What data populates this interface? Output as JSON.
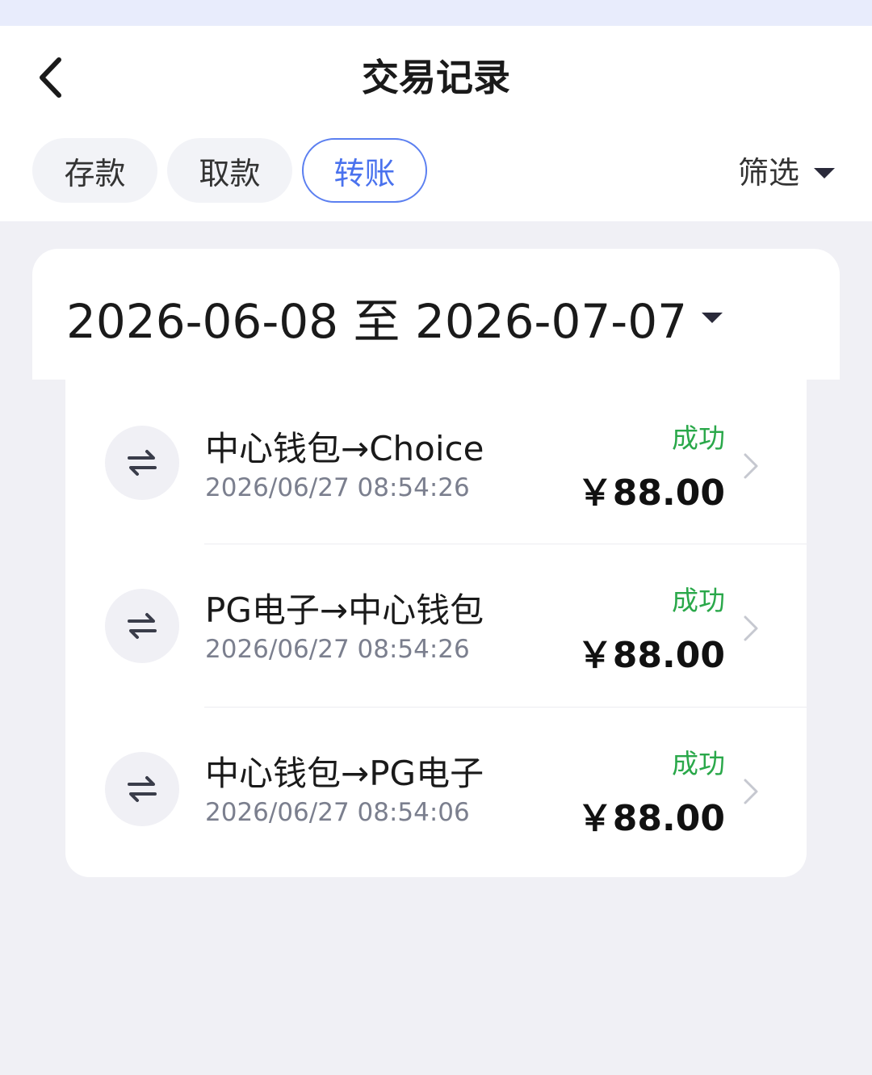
{
  "header": {
    "title": "交易记录",
    "back_icon": "chevron-left-icon"
  },
  "tabs": [
    {
      "label": "存款",
      "active": false
    },
    {
      "label": "取款",
      "active": false
    },
    {
      "label": "转账",
      "active": true
    }
  ],
  "filter": {
    "label": "筛选",
    "icon": "caret-down-icon"
  },
  "date_range": {
    "text": "2026-06-08 至 2026-07-07",
    "icon": "caret-down-icon"
  },
  "transactions": [
    {
      "title": "中心钱包→Choice",
      "time": "2026/06/27 08:54:26",
      "status": "成功",
      "amount": "￥88.00",
      "icon": "transfer-icon"
    },
    {
      "title": "PG电子→中心钱包",
      "time": "2026/06/27 08:54:26",
      "status": "成功",
      "amount": "￥88.00",
      "icon": "transfer-icon"
    },
    {
      "title": "中心钱包→PG电子",
      "time": "2026/06/27 08:54:06",
      "status": "成功",
      "amount": "￥88.00",
      "icon": "transfer-icon"
    }
  ],
  "colors": {
    "accent": "#4a72ee",
    "success": "#2aa84a",
    "background": "#f0f0f5"
  }
}
